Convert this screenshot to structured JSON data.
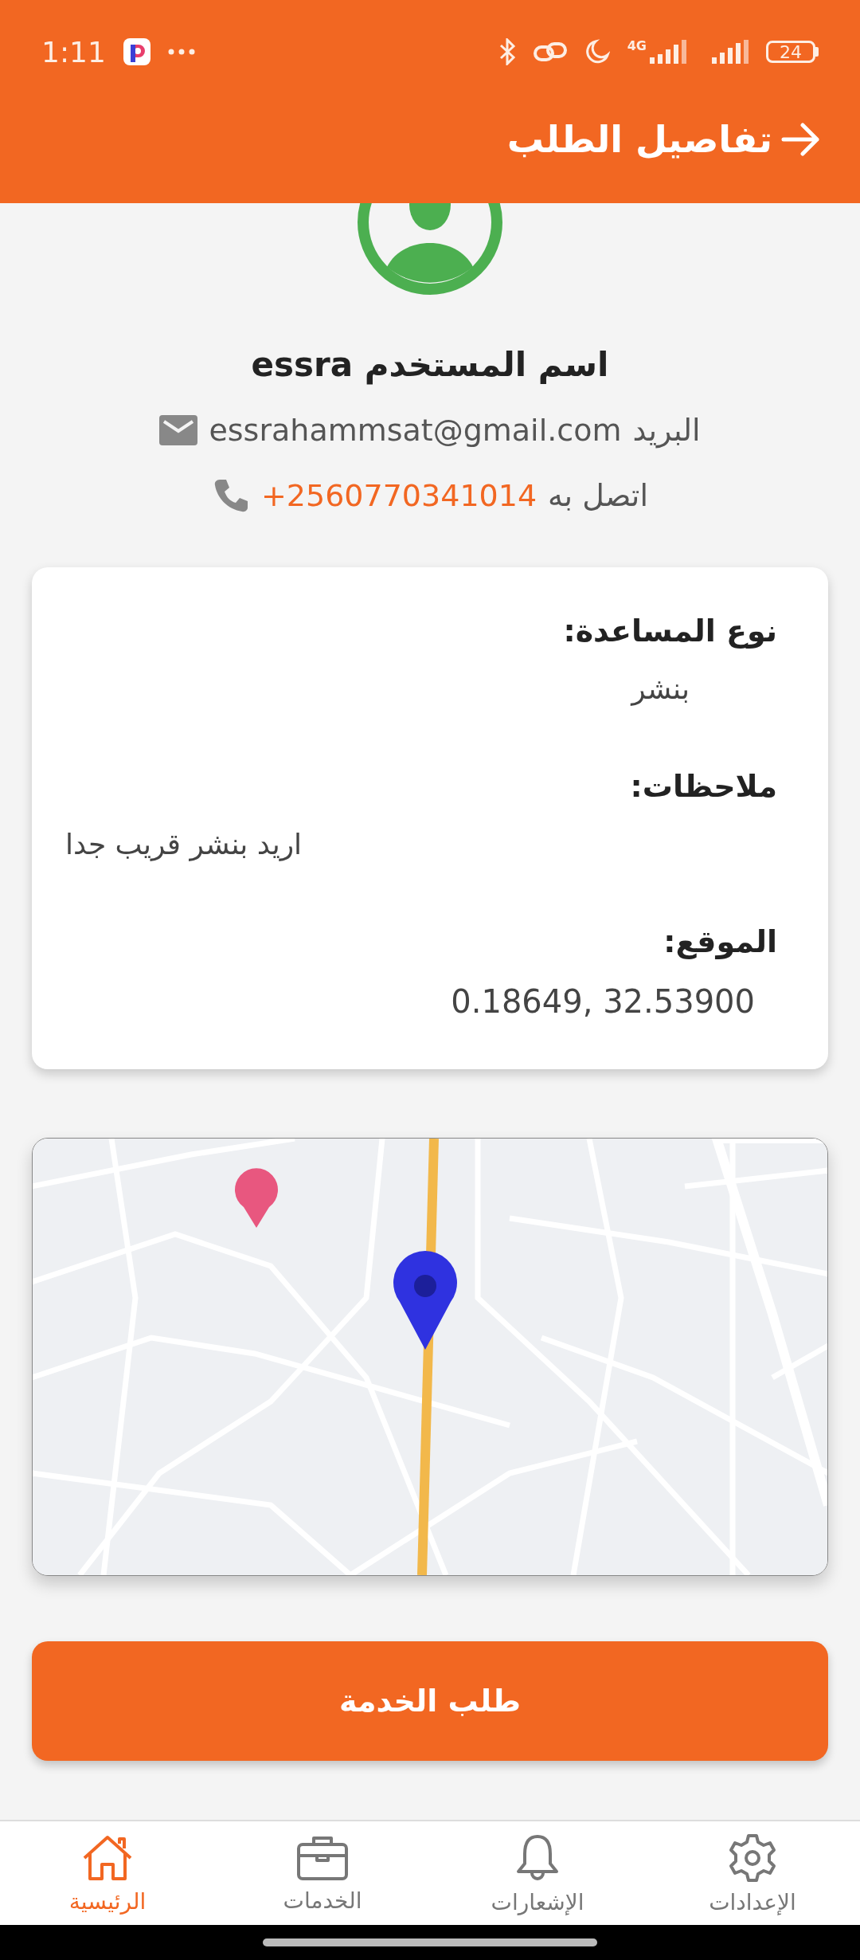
{
  "status_bar": {
    "time": "1:11",
    "network": "4G",
    "battery": "24"
  },
  "header": {
    "title": "تفاصيل الطلب"
  },
  "profile": {
    "name_label": "اسم المستخدم",
    "name": "essra",
    "email_label": "البريد",
    "email": "essrahammsat@gmail.com",
    "phone_label": "اتصل به",
    "phone": "+2560770341014"
  },
  "details": [
    {
      "label": "نوع المساعدة:",
      "value": "بنشر"
    },
    {
      "label": "ملاحظات:",
      "value": "اريد بنشر قريب جدا"
    },
    {
      "label": "الموقع:",
      "value": "0.18649, 32.53900"
    }
  ],
  "action_button": "طلب الخدمة",
  "bottom_nav": [
    {
      "label": "الإعدادات",
      "kind": "settings",
      "selected": false
    },
    {
      "label": "الإشعارات",
      "kind": "notifications",
      "selected": false
    },
    {
      "label": "الخدمات",
      "kind": "services",
      "selected": false
    },
    {
      "label": "الرئيسية",
      "kind": "home",
      "selected": true
    }
  ]
}
